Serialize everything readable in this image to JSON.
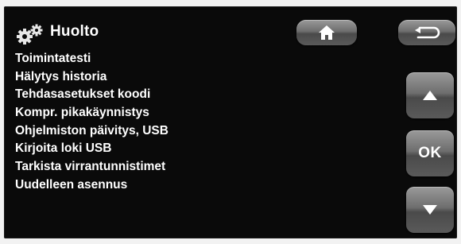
{
  "header": {
    "title": "Huolto",
    "icon": "gears-icon"
  },
  "menu": {
    "items": [
      {
        "label": "Toimintatesti"
      },
      {
        "label": "Hälytys historia"
      },
      {
        "label": "Tehdasasetukset koodi"
      },
      {
        "label": "Kompr. pikakäynnistys"
      },
      {
        "label": "Ohjelmiston päivitys, USB"
      },
      {
        "label": "Kirjoita loki USB"
      },
      {
        "label": "Tarkista virrantunnistimet"
      },
      {
        "label": "Uudelleen asennus"
      }
    ]
  },
  "nav": {
    "home_icon": "home-icon",
    "back_icon": "back-arrow-icon",
    "up_icon": "arrow-up-icon",
    "ok_label": "OK",
    "down_icon": "arrow-down-icon"
  },
  "colors": {
    "screen_bg": "#0a0a0a",
    "text": "#ffffff",
    "button_gray": "#6e6e6e",
    "bezel": "#f2f2f2"
  }
}
